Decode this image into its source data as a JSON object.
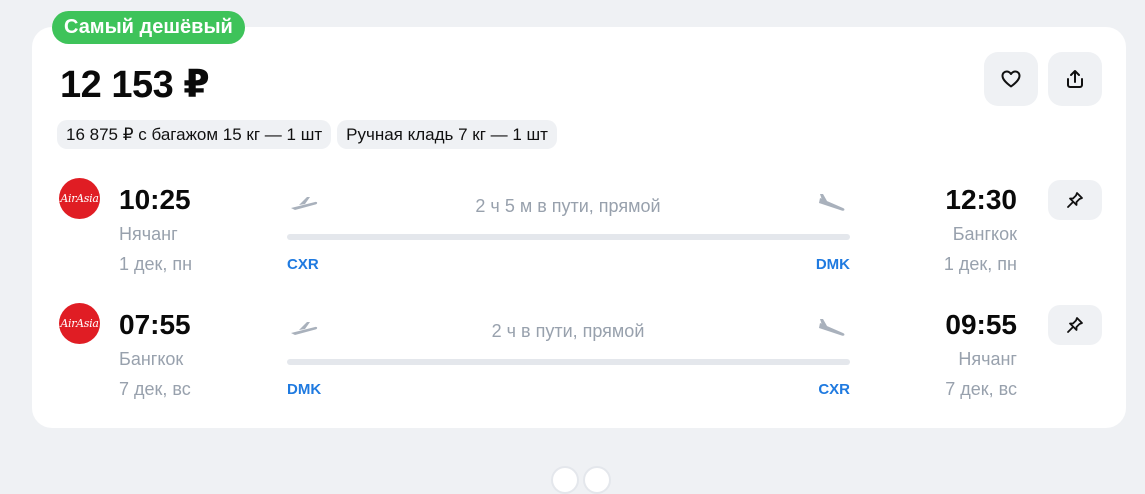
{
  "badge": {
    "label": "Самый дешёвый",
    "color": "#3ec35a"
  },
  "price": "12 153 ₽",
  "actions": {
    "favorite_icon": "heart-icon",
    "share_icon": "share-icon"
  },
  "chips": [
    "16 875 ₽ с багажом 15 кг — 1 шт",
    "Ручная кладь 7 кг — 1 шт"
  ],
  "legs": [
    {
      "airline_logo_text": "AirAsia",
      "dep_time": "10:25",
      "dep_city": "Нячанг",
      "dep_date": "1 дек, пн",
      "dep_iata": "CXR",
      "duration": "2 ч 5 м в пути, прямой",
      "arr_time": "12:30",
      "arr_city": "Бангкок",
      "arr_date": "1 дек, пн",
      "arr_iata": "DMK"
    },
    {
      "airline_logo_text": "AirAsia",
      "dep_time": "07:55",
      "dep_city": "Бангкок",
      "dep_date": "7 дек, вс",
      "dep_iata": "DMK",
      "duration": "2 ч в пути, прямой",
      "arr_time": "09:55",
      "arr_city": "Нячанг",
      "arr_date": "7 дек, вс",
      "arr_iata": "CXR"
    }
  ],
  "colors": {
    "accent": "#1f7ae0",
    "airline": "#e01d24",
    "muted": "#98a1ad"
  }
}
